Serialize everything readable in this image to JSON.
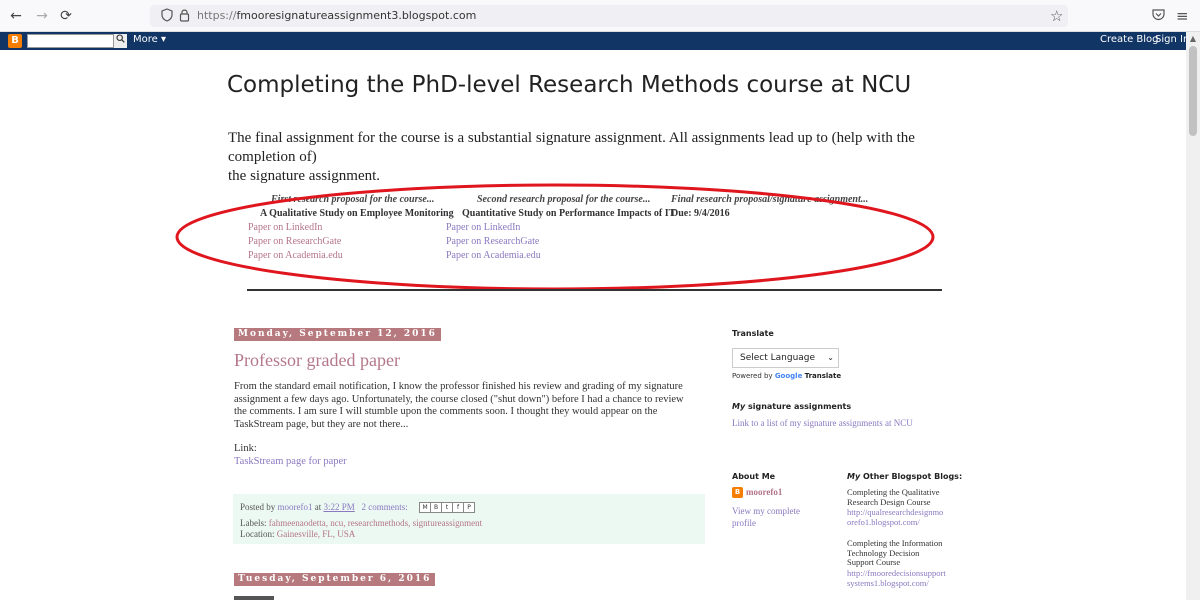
{
  "browser": {
    "back_icon": "←",
    "forward_icon": "→",
    "reload_icon": "⟳",
    "shield_icon": "shield-icon",
    "lock_icon": "lock-icon",
    "url_scheme": "https://",
    "url_host": "fmooresignatureassignment3.blogspot.com",
    "bookmark_icon": "☆",
    "pocket_icon": "pocket-icon",
    "menu_icon": "≡"
  },
  "navbar": {
    "logo_letter": "B",
    "search_placeholder": "",
    "more_label": "More ▾",
    "create_blog_label": "Create Blog",
    "sign_in_label": "Sign In"
  },
  "header": {
    "title": "Completing the PhD-level Research Methods course at NCU",
    "description_line1": "The final assignment for the course is a substantial signature assignment. All assignments lead up to (help with the completion of)",
    "description_line2": "the signature assignment."
  },
  "assignments": [
    {
      "heading": "First research proposal for the course...",
      "title": "A Qualitative Study on Employee Monitoring",
      "links": [
        "Paper on LinkedIn",
        "Paper on ResearchGate",
        "Paper on Academia.edu"
      ]
    },
    {
      "heading": "Second research proposal for the course...",
      "title": "Quantitative Study on Performance Impacts of IT",
      "links": [
        "Paper on LinkedIn",
        "Paper on ResearchGate",
        "Paper on Academia.edu"
      ]
    },
    {
      "heading": "Final research proposal/signature assignment...",
      "title": "Due: 9/4/2016",
      "links": []
    }
  ],
  "colors": {
    "navbar_bg": "#113565",
    "date_badge_bg": "#b67a7e",
    "post_title": "#b4788a",
    "link_purple": "#8a79c0",
    "link_rose": "#b47488",
    "footer_bg": "#ecf9f3",
    "annotation_red": "#e0161e"
  },
  "posts": [
    {
      "date": "Monday, September 12, 2016",
      "title": "Professor graded paper",
      "body": "From the standard email notification, I know the professor finished his review and grading of my signature assignment a few days ago. Unfortunately, the course closed (\"shut down\") before I had a chance to review the comments. I am sure I will stumble upon the comments soon. I thought they would appear on the TaskStream page, but they are not there...",
      "link_label": "Link:",
      "link_text": "TaskStream page for paper",
      "posted_by_prefix": "Posted by",
      "author": "moorefo1",
      "at_word": "at",
      "time": "3:22 PM",
      "comments": "2 comments:",
      "share_buttons": [
        "M",
        "B",
        "t",
        "f",
        "P"
      ],
      "labels_prefix": "Labels:",
      "labels": "fahmeenaodetta, ncu, researchmethods, signtureassignment",
      "location_prefix": "Location:",
      "location": "Gainesville, FL, USA"
    },
    {
      "date": "Tuesday, September 6, 2016"
    }
  ],
  "sidebar": {
    "translate_heading": "Translate",
    "language_select": "Select Language",
    "powered_by": "Powered by",
    "google_word": "Google",
    "translate_word": "Translate",
    "sig_heading_prefix": "My",
    "sig_heading_rest": "signature assignments",
    "sig_link": "Link to a list of my signature assignments at NCU",
    "about_heading": "About Me",
    "profile_name": "moorefo1",
    "view_profile_line1": "View my complete",
    "view_profile_line2": "profile",
    "other_blogs_heading_prefix": "My",
    "other_blogs_heading_rest": "Other Blogspot Blogs:",
    "blogs": [
      {
        "lines": [
          "Completing the Qualitative",
          "Research Design Course"
        ],
        "url_lines": [
          "http://qualresearchdesignmo",
          "orefo1.blogspot.com/"
        ]
      },
      {
        "lines": [
          "Completing the Information",
          "Technology Decision",
          "Support Course"
        ],
        "url_lines": [
          "http://fmooredecisionsupport",
          "systems1.blogspot.com/"
        ]
      }
    ]
  }
}
